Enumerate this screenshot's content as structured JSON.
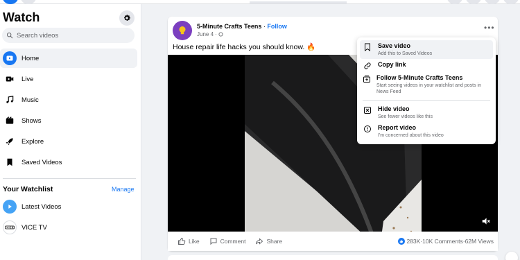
{
  "sidebar": {
    "title": "Watch",
    "search_placeholder": "Search videos",
    "items": [
      {
        "label": "Home"
      },
      {
        "label": "Live"
      },
      {
        "label": "Music"
      },
      {
        "label": "Shows"
      },
      {
        "label": "Explore"
      },
      {
        "label": "Saved Videos"
      }
    ],
    "watchlist_title": "Your Watchlist",
    "manage_label": "Manage",
    "watchlist": [
      {
        "label": "Latest Videos"
      },
      {
        "label": "VICE TV"
      }
    ]
  },
  "post": {
    "page_name": "5-Minute Crafts Teens",
    "separator": " · ",
    "follow_label": "Follow",
    "date": "June 4 · ",
    "text": "House repair life hacks you should know. 🔥",
    "actions": {
      "like": "Like",
      "comment": "Comment",
      "share": "Share"
    },
    "stats": {
      "reactions": "283K",
      "comments": "10K Comments",
      "views": "62M Views",
      "separator": " · "
    }
  },
  "menu": {
    "items": [
      {
        "label": "Save video",
        "sub": "Add this to Saved Videos",
        "icon": "bookmark-icon"
      },
      {
        "label": "Copy link",
        "sub": "",
        "icon": "link-icon"
      },
      {
        "label": "Follow 5-Minute Crafts Teens",
        "sub": "Start seeing videos in your watchlist and posts in News Feed",
        "icon": "follow-icon"
      },
      {
        "label": "Hide video",
        "sub": "See fewer videos like this",
        "icon": "hide-icon"
      },
      {
        "label": "Report video",
        "sub": "I'm concerned about this video",
        "icon": "report-icon"
      }
    ]
  },
  "colors": {
    "accent": "#1877f2",
    "background": "#f0f2f5",
    "secondary_text": "#65676b"
  }
}
